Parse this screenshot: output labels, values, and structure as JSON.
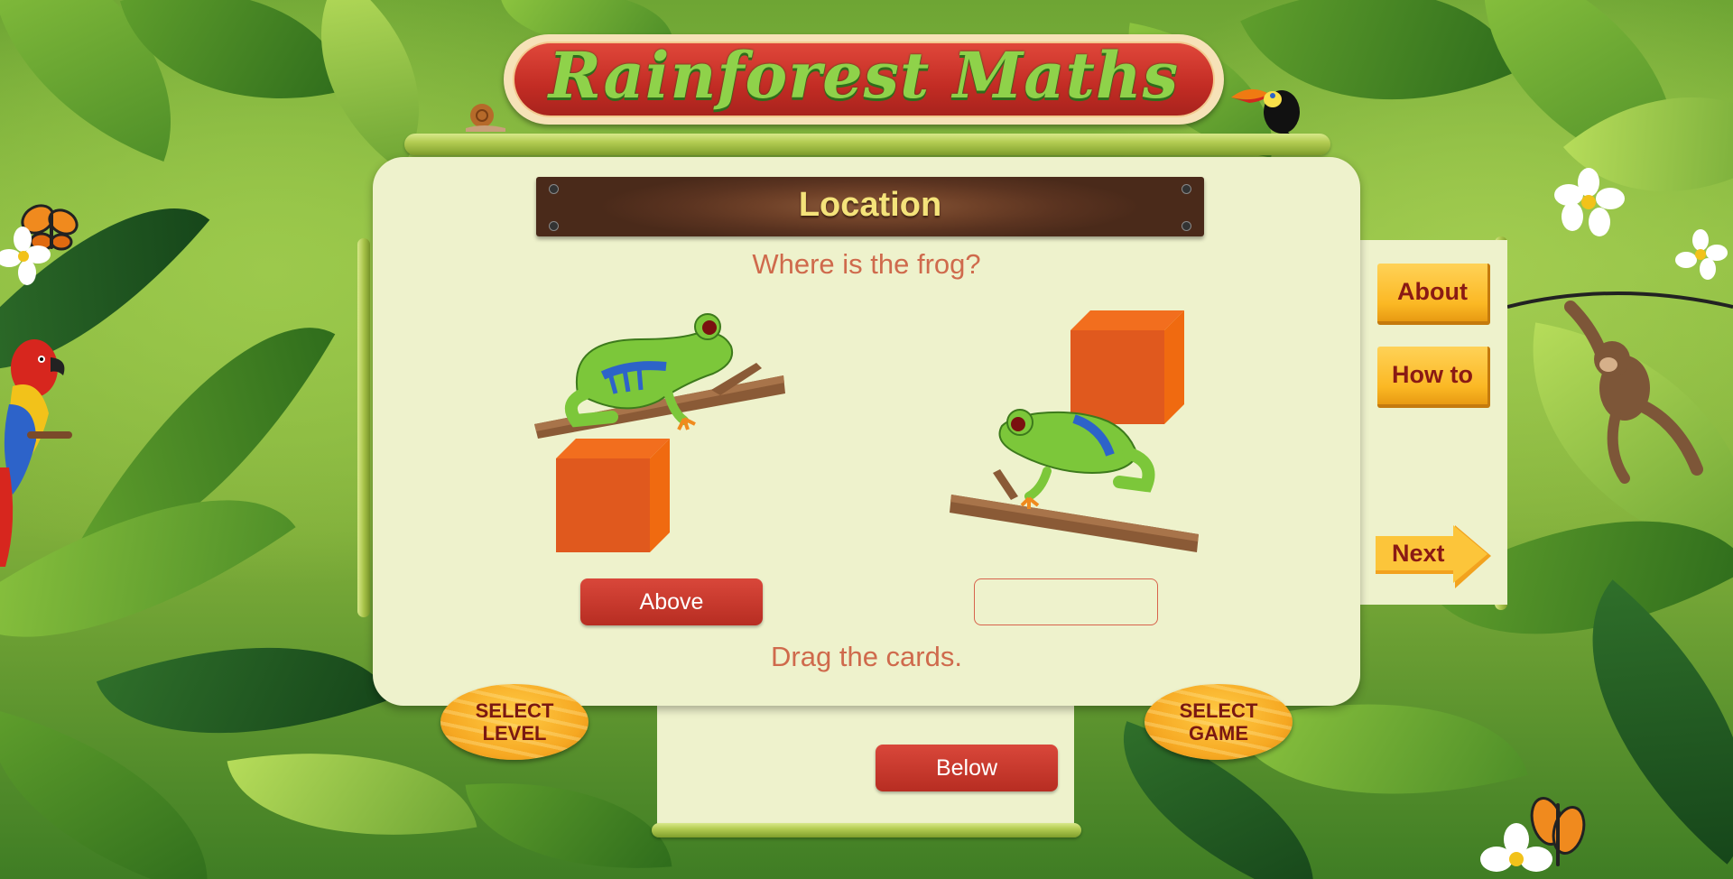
{
  "app": {
    "title": "Rainforest Maths"
  },
  "activity": {
    "topic": "Location",
    "question": "Where is the frog?",
    "instruction": "Drag the cards."
  },
  "scenes": [
    {
      "frog_position": "above",
      "placed_card": "Above"
    },
    {
      "frog_position": "below",
      "placed_card": ""
    }
  ],
  "cards": {
    "placed_left": "Above",
    "tray": [
      "Below"
    ]
  },
  "nav": {
    "about": "About",
    "how_to": "How to",
    "next": "Next",
    "select_level": [
      "SELECT",
      "LEVEL"
    ],
    "select_game": [
      "SELECT",
      "GAME"
    ]
  },
  "colors": {
    "panel": "#eef2cc",
    "card": "#c93a2e",
    "text_accent": "#cf6a4c",
    "button_gold": "#fbb824",
    "cube": "#e05a1e"
  },
  "icons": [
    "frog-icon",
    "branch-icon",
    "cube-icon",
    "toucan-icon",
    "parrot-icon",
    "snail-icon",
    "butterfly-icon",
    "monkey-icon",
    "flower-icon",
    "arrow-right-icon"
  ]
}
